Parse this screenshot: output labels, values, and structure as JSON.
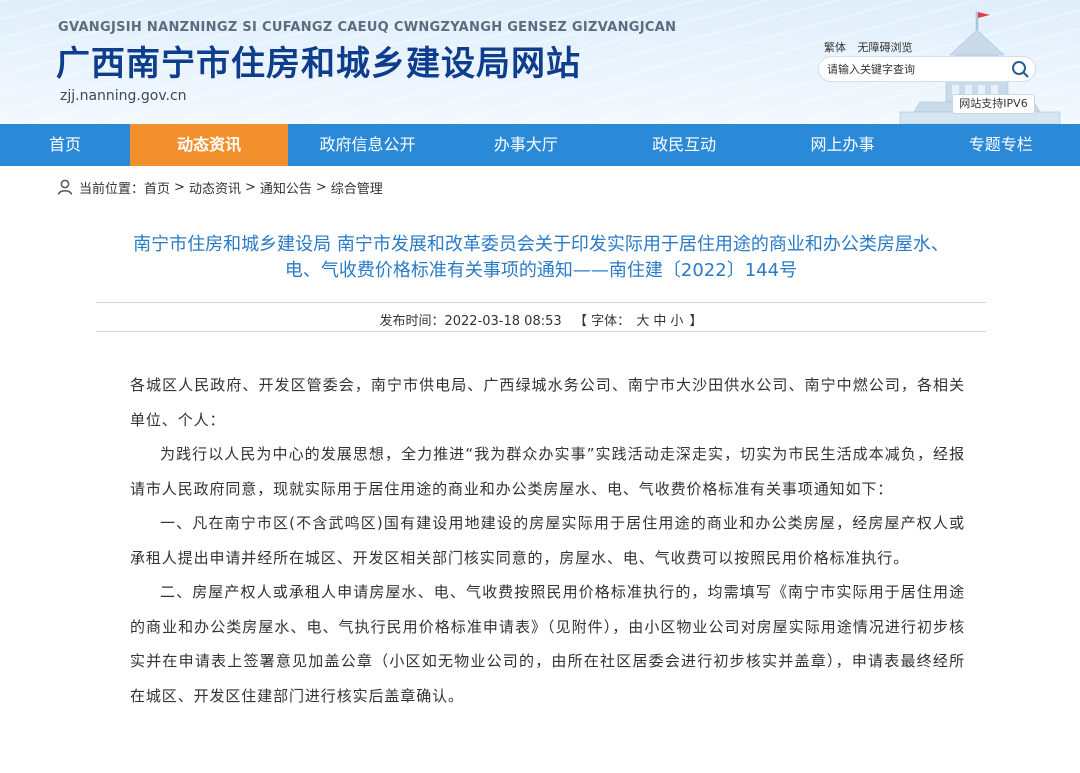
{
  "header": {
    "pinyin": "GVANGJSIH NANZNINGZ SI CUFANGZ CAEUQ CWNGZYANGH GENSEZ GIZVANGJCAN",
    "site_title": "广西南宁市住房和城乡建设局网站",
    "domain": "zjj.nanning.gov.cn",
    "links": {
      "traditional": "繁体",
      "accessibility": "无障碍浏览"
    },
    "search": {
      "placeholder": "请输入关键字查询"
    },
    "ipv6": "网站支持IPV6"
  },
  "nav": {
    "items": [
      "首页",
      "动态资讯",
      "政府信息公开",
      "办事大厅",
      "政民互动",
      "网上办事",
      "专题专栏"
    ],
    "active": "动态资讯"
  },
  "breadcrumb": {
    "prefix": "当前位置：",
    "items": [
      "首页",
      "动态资讯",
      "通知公告",
      "综合管理"
    ],
    "separator": ">"
  },
  "article": {
    "title_line1": "南宁市住房和城乡建设局 南宁市发展和改革委员会关于印发实际用于居住用途的商业和办公类房屋水、",
    "title_line2": "电、气收费价格标准有关事项的通知——南住建〔2022〕144号",
    "meta": {
      "publish_label": "发布时间：",
      "publish_time": "2022-03-18 08:53",
      "font_open": "【 字体：",
      "font_large": "大",
      "font_medium": "中",
      "font_small": "小",
      "font_close": "】"
    },
    "paragraphs": [
      "各城区人民政府、开发区管委会，南宁市供电局、广西绿城水务公司、南宁市大沙田供水公司、南宁中燃公司，各相关单位、个人：",
      "为践行以人民为中心的发展思想，全力推进“我为群众办实事”实践活动走深走实，切实为市民生活成本减负，经报请市人民政府同意，现就实际用于居住用途的商业和办公类房屋水、电、气收费价格标准有关事项通知如下：",
      "一、凡在南宁市区(不含武鸣区)国有建设用地建设的房屋实际用于居住用途的商业和办公类房屋，经房屋产权人或承租人提出申请并经所在城区、开发区相关部门核实同意的，房屋水、电、气收费可以按照民用价格标准执行。",
      "二、房屋产权人或承租人申请房屋水、电、气收费按照民用价格标准执行的，均需填写《南宁市实际用于居住用途的商业和办公类房屋水、电、气执行民用价格标准申请表》（见附件），由小区物业公司对房屋实际用途情况进行初步核实并在申请表上签署意见加盖公章（小区如无物业公司的，由所在社区居委会进行初步核实并盖章），申请表最终经所在城区、开发区住建部门进行核实后盖章确认。"
    ]
  },
  "colors": {
    "nav_bg": "#2b8ad7",
    "nav_active": "#f3902e",
    "title_color": "#2a7ac7",
    "site_title_color": "#0d3d8c"
  }
}
